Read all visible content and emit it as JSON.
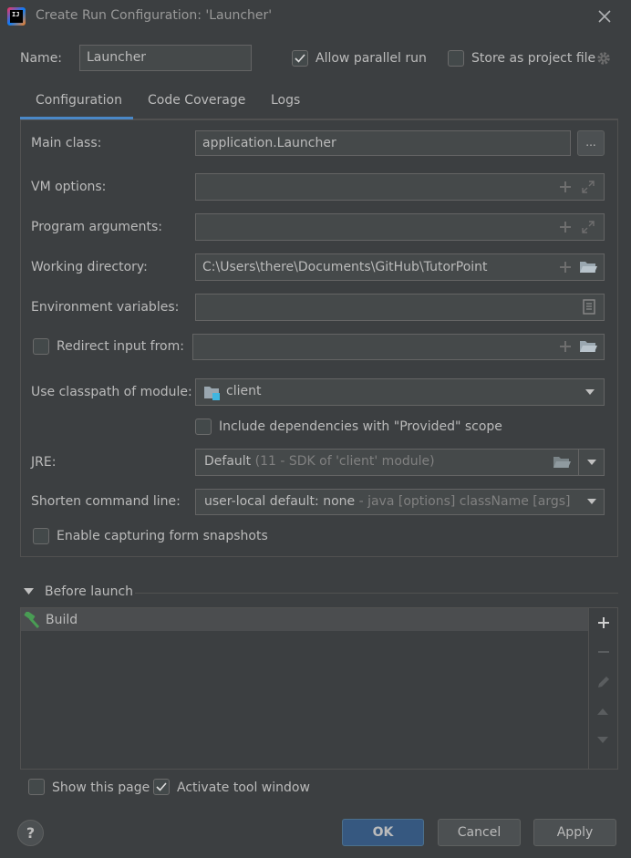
{
  "window": {
    "title": "Create Run Configuration: 'Launcher'",
    "app_logo_text": "IJ"
  },
  "header": {
    "name_label": "Name:",
    "name_value": "Launcher",
    "allow_parallel_label": "Allow parallel run",
    "allow_parallel_checked": true,
    "store_project_label": "Store as project file",
    "store_project_checked": false
  },
  "tabs": [
    {
      "label": "Configuration",
      "active": true
    },
    {
      "label": "Code Coverage",
      "active": false
    },
    {
      "label": "Logs",
      "active": false
    }
  ],
  "config": {
    "main_class_label": "Main class:",
    "main_class_value": "application.Launcher",
    "browse_label": "...",
    "vm_options_label": "VM options:",
    "vm_options_value": "",
    "program_args_label": "Program arguments:",
    "program_args_value": "",
    "working_dir_label": "Working directory:",
    "working_dir_value": "C:\\Users\\there\\Documents\\GitHub\\TutorPoint",
    "env_vars_label": "Environment variables:",
    "env_vars_value": "",
    "redirect_label": "Redirect input from:",
    "redirect_checked": false,
    "redirect_value": "",
    "classpath_label": "Use classpath of module:",
    "classpath_value": "client",
    "include_deps_label": "Include dependencies with \"Provided\" scope",
    "include_deps_checked": false,
    "jre_label": "JRE:",
    "jre_value": "Default",
    "jre_hint": "(11 - SDK of 'client' module)",
    "shorten_label": "Shorten command line:",
    "shorten_value": "user-local default: none",
    "shorten_hint": "- java [options] className [args]",
    "snapshots_label": "Enable capturing form snapshots",
    "snapshots_checked": false
  },
  "before_launch": {
    "title": "Before launch",
    "items": [
      {
        "label": "Build",
        "icon": "hammer-icon"
      }
    ]
  },
  "footer": {
    "show_page_label": "Show this page",
    "show_page_checked": false,
    "activate_tool_label": "Activate tool window",
    "activate_tool_checked": true,
    "help_label": "?",
    "ok_label": "OK",
    "cancel_label": "Cancel",
    "apply_label": "Apply"
  },
  "colors": {
    "background": "#3c3f41",
    "field": "#45494a",
    "accent": "#4a88c7",
    "primary_button": "#365880",
    "hammer": "#499c54",
    "module_blue": "#40b6e0"
  }
}
